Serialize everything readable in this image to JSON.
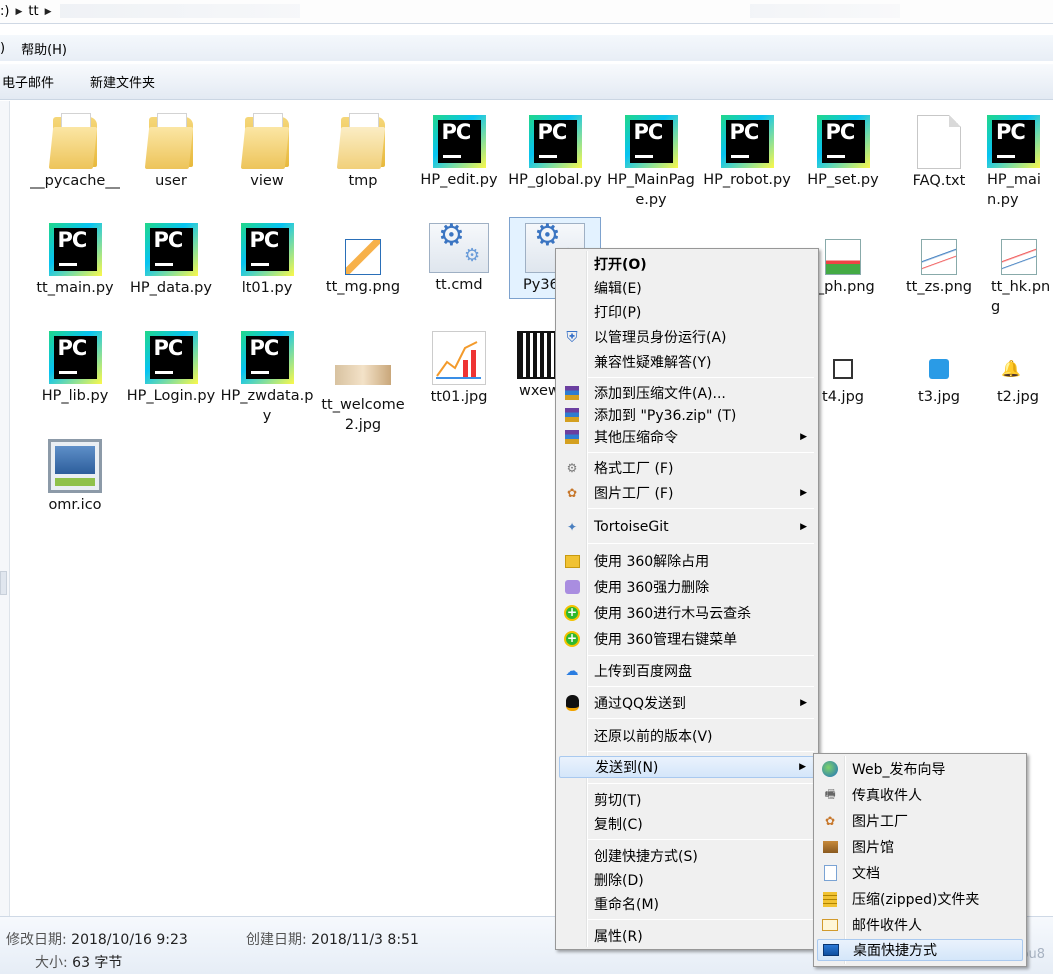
{
  "address": {
    "drive_fragment": ":)",
    "folder": "tt"
  },
  "menubar": {
    "help": "帮助(H)",
    "left_fragment": ")"
  },
  "toolbar": {
    "email": "电子邮件",
    "new_folder": "新建文件夹"
  },
  "files": [
    {
      "name": "__pycache__",
      "type": "folder"
    },
    {
      "name": "user",
      "type": "folder"
    },
    {
      "name": "view",
      "type": "folder"
    },
    {
      "name": "tmp",
      "type": "folder"
    },
    {
      "name": "HP_edit.py",
      "type": "pycharm"
    },
    {
      "name": "HP_global.py",
      "type": "pycharm"
    },
    {
      "name": "HP_MainPage.py",
      "type": "pycharm"
    },
    {
      "name": "HP_robot.py",
      "type": "pycharm"
    },
    {
      "name": "HP_set.py",
      "type": "pycharm"
    },
    {
      "name": "FAQ.txt",
      "type": "txt"
    },
    {
      "name": "HP_main.py",
      "type": "pycharm"
    },
    {
      "name": "tt_main.py",
      "type": "pycharm"
    },
    {
      "name": "HP_data.py",
      "type": "pycharm"
    },
    {
      "name": "lt01.py",
      "type": "pycharm"
    },
    {
      "name": "tt_mg.png",
      "type": "image"
    },
    {
      "name": "tt.cmd",
      "type": "cmd"
    },
    {
      "name": "Py36",
      "type": "cmd"
    },
    {
      "name": "t_ph.png",
      "type": "image"
    },
    {
      "name": "tt_zs.png",
      "type": "image"
    },
    {
      "name": "tt_hk.png",
      "type": "image"
    },
    {
      "name": "HP_lib.py",
      "type": "pycharm"
    },
    {
      "name": "HP_Login.py",
      "type": "pycharm"
    },
    {
      "name": "HP_zwdata.py",
      "type": "pycharm"
    },
    {
      "name": "tt_welcome2.jpg",
      "type": "image"
    },
    {
      "name": "tt01.jpg",
      "type": "chart"
    },
    {
      "name": "wxew",
      "type": "qr"
    },
    {
      "name": "t4.jpg",
      "type": "small"
    },
    {
      "name": "t3.jpg",
      "type": "small"
    },
    {
      "name": "t2.jpg",
      "type": "small"
    },
    {
      "name": "omr.ico",
      "type": "ico"
    }
  ],
  "context_menu": {
    "open": "打开(O)",
    "edit": "编辑(E)",
    "print": "打印(P)",
    "run_as_admin": "以管理员身份运行(A)",
    "compat": "兼容性疑难解答(Y)",
    "add_archive": "添加到压缩文件(A)...",
    "add_zip": "添加到 \"Py36.zip\" (T)",
    "other_compress": "其他压缩命令",
    "format_factory": "格式工厂 (F)",
    "picture_factory": "图片工厂 (F)",
    "tortoisegit": "TortoiseGit",
    "unlock_360": "使用 360解除占用",
    "force_delete_360": "使用 360强力删除",
    "scan_360": "使用 360进行木马云查杀",
    "manage_360": "使用 360管理右键菜单",
    "baidu": "上传到百度网盘",
    "qq": "通过QQ发送到",
    "restore": "还原以前的版本(V)",
    "send_to": "发送到(N)",
    "cut": "剪切(T)",
    "copy": "复制(C)",
    "shortcut": "创建快捷方式(S)",
    "delete": "删除(D)",
    "rename": "重命名(M)",
    "properties": "属性(R)"
  },
  "send_to_menu": {
    "web_publish": "Web_发布向导",
    "fax": "传真收件人",
    "picture_factory": "图片工厂",
    "picture_gallery": "图片馆",
    "documents": "文档",
    "zip": "压缩(zipped)文件夹",
    "mail": "邮件收件人",
    "desktop": "桌面快捷方式"
  },
  "status": {
    "modified_label": "修改日期:",
    "modified_value": "2018/10/16 9:23",
    "created_label": "创建日期:",
    "created_value": "2018/11/3 8:51",
    "size_label": "大小:",
    "size_value": "63 字节",
    "watermark": "csdn.net/hspu8"
  },
  "colors": {
    "menu_bg": "#f0f0f0",
    "highlight": "#d4e6fa",
    "pycharm_black": "#000000",
    "folder_yellow": "#edc45a"
  }
}
